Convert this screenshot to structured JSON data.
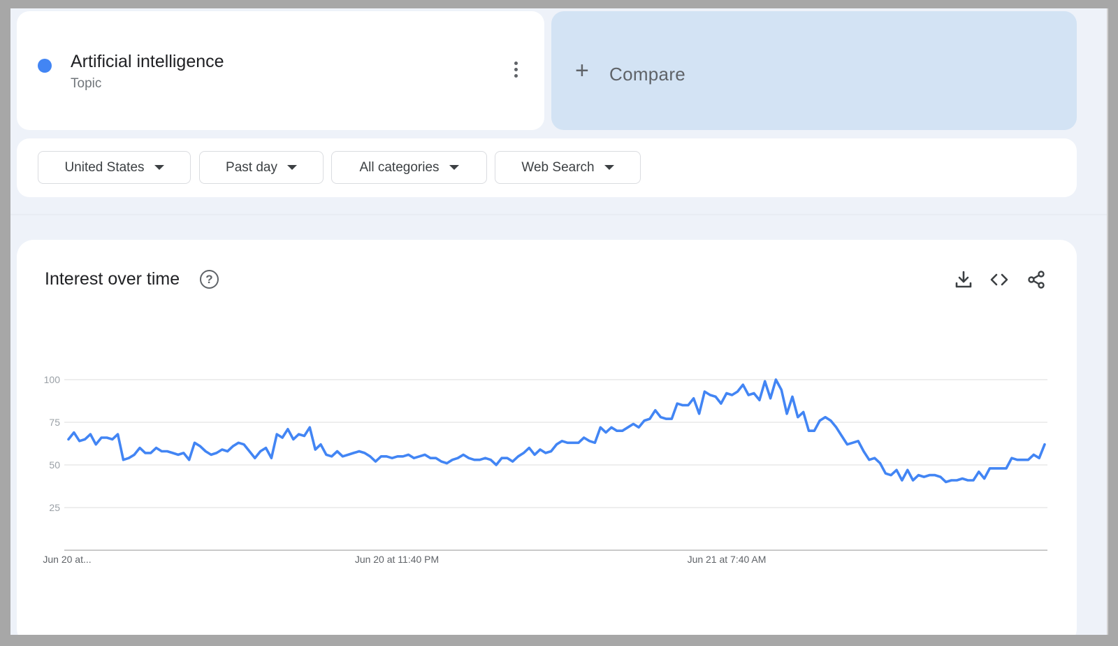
{
  "term": {
    "title": "Artificial intelligence",
    "subtitle": "Topic",
    "color": "#4285f4",
    "menu_icon": "more-vert-icon"
  },
  "compare": {
    "icon": "plus-icon",
    "label": "Compare"
  },
  "filters": [
    {
      "label": "United States",
      "icon": "arrow-drop-down-icon"
    },
    {
      "label": "Past day",
      "icon": "arrow-drop-down-icon"
    },
    {
      "label": "All categories",
      "icon": "arrow-drop-down-icon"
    },
    {
      "label": "Web Search",
      "icon": "arrow-drop-down-icon"
    }
  ],
  "chart_section": {
    "title": "Interest over time",
    "help_icon": "help-icon",
    "actions": [
      "download-icon",
      "embed-code-icon",
      "share-icon"
    ]
  },
  "chart_data": {
    "type": "line",
    "title": "",
    "xlabel": "",
    "ylabel": "",
    "ylim": [
      0,
      100
    ],
    "yticks": [
      25,
      50,
      75,
      100
    ],
    "xtick_labels": [
      "Jun 20 at...",
      "Jun 20 at 11:40 PM",
      "Jun 21 at 7:40 AM"
    ],
    "grid": true,
    "series": [
      {
        "color": "#4285f4",
        "values": [
          65,
          69,
          64,
          65,
          68,
          62,
          66,
          66,
          65,
          68,
          53,
          54,
          56,
          60,
          57,
          57,
          60,
          58,
          58,
          57,
          56,
          57,
          53,
          63,
          61,
          58,
          56,
          57,
          59,
          58,
          61,
          63,
          62,
          58,
          54,
          58,
          60,
          54,
          68,
          66,
          71,
          65,
          68,
          67,
          72,
          59,
          62,
          56,
          55,
          58,
          55,
          56,
          57,
          58,
          57,
          55,
          52,
          55,
          55,
          54,
          55,
          55,
          56,
          54,
          55,
          56,
          54,
          54,
          52,
          51,
          53,
          54,
          56,
          54,
          53,
          53,
          54,
          53,
          50,
          54,
          54,
          52,
          55,
          57,
          60,
          56,
          59,
          57,
          58,
          62,
          64,
          63,
          63,
          63,
          66,
          64,
          63,
          72,
          69,
          72,
          70,
          70,
          72,
          74,
          72,
          76,
          77,
          82,
          78,
          77,
          77,
          86,
          85,
          85,
          89,
          80,
          93,
          91,
          90,
          86,
          92,
          91,
          93,
          97,
          91,
          92,
          88,
          99,
          89,
          100,
          94,
          80,
          90,
          78,
          81,
          70,
          70,
          76,
          78,
          76,
          72,
          67,
          62,
          63,
          64,
          58,
          53,
          54,
          51,
          45,
          44,
          47,
          41,
          47,
          41,
          44,
          43,
          44,
          44,
          43,
          40,
          41,
          41,
          42,
          41,
          41,
          46,
          42,
          48,
          48,
          48,
          48,
          54,
          53,
          53,
          53,
          56,
          54,
          62
        ]
      }
    ]
  }
}
